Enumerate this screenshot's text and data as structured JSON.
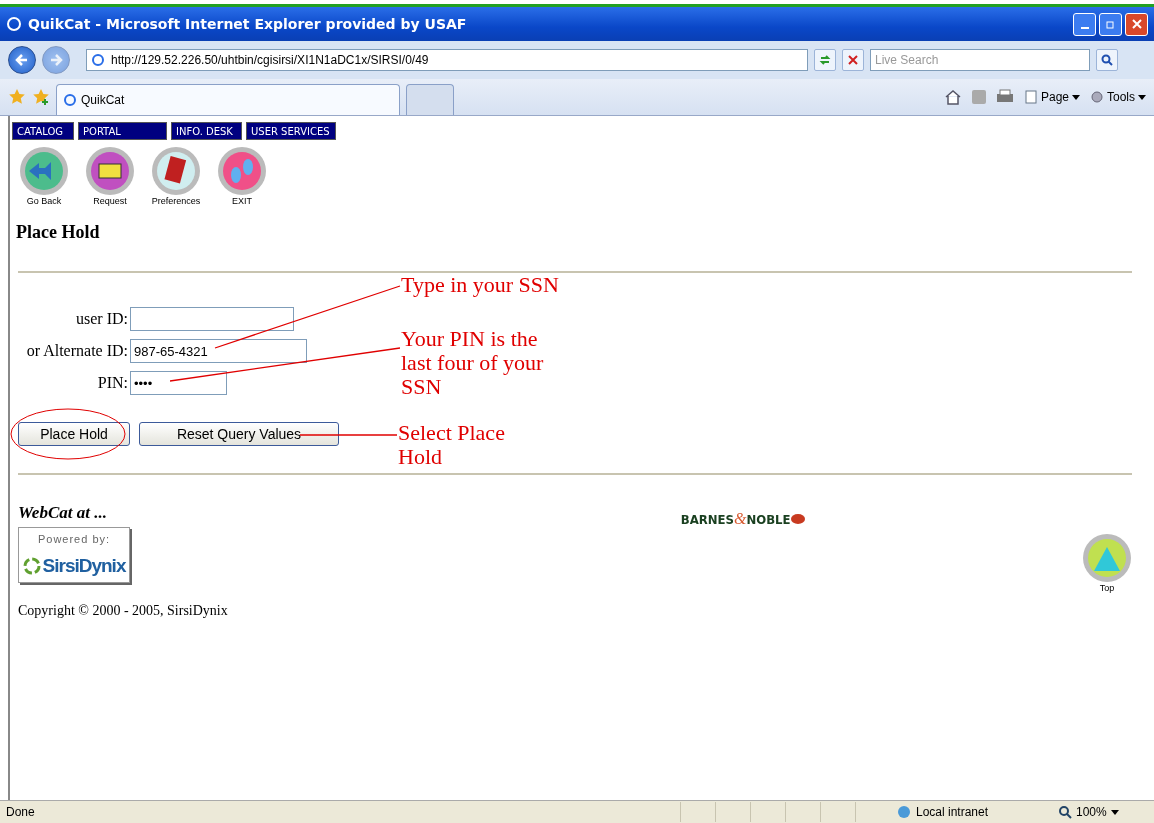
{
  "window": {
    "title": "QuikCat - Microsoft Internet Explorer provided by USAF"
  },
  "address_bar": {
    "url": "http://129.52.226.50/uhtbin/cgisirsi/XI1N1aDC1x/SIRSI/0/49"
  },
  "search": {
    "placeholder": "Live Search"
  },
  "browser_tabs": [
    {
      "label": "QuikCat",
      "selected": true
    }
  ],
  "command_bar": [
    "Page",
    "Tools"
  ],
  "site_nav": [
    {
      "label": "CATALOG"
    },
    {
      "label": "PORTAL"
    },
    {
      "label": "INFO. DESK"
    },
    {
      "label": "USER SERVICES"
    }
  ],
  "icon_nav": [
    {
      "label": "Go Back",
      "kind": "back"
    },
    {
      "label": "Request",
      "kind": "request"
    },
    {
      "label": "Preferences",
      "kind": "prefs"
    },
    {
      "label": "EXIT",
      "kind": "exit"
    }
  ],
  "heading": "Place Hold",
  "fields": [
    {
      "label": "user ID:"
    },
    {
      "label": "or Alternate ID:",
      "value": "987-65-4321"
    },
    {
      "label": "PIN:",
      "value": "••••"
    }
  ],
  "buttons": [
    {
      "label": "Place Hold",
      "circled": true
    },
    {
      "label": "Reset Query Values",
      "circled": false
    }
  ],
  "annotations": [
    "Type in your SSN",
    "Your PIN is the last four of your SSN",
    "Select Place Hold"
  ],
  "footer": {
    "webcat": "WebCat at ...",
    "powered_by": "Powered by:",
    "sirsi_logo": "SirsiDynix",
    "bn_logo": [
      "BARNES",
      "&",
      "NOBLE"
    ],
    "top_label": "Top",
    "copyright": "Copyright © 2000 - 2005, SirsiDynix"
  },
  "status_bar": {
    "status": "Done",
    "zone": "Local intranet",
    "zoom": "100%"
  }
}
